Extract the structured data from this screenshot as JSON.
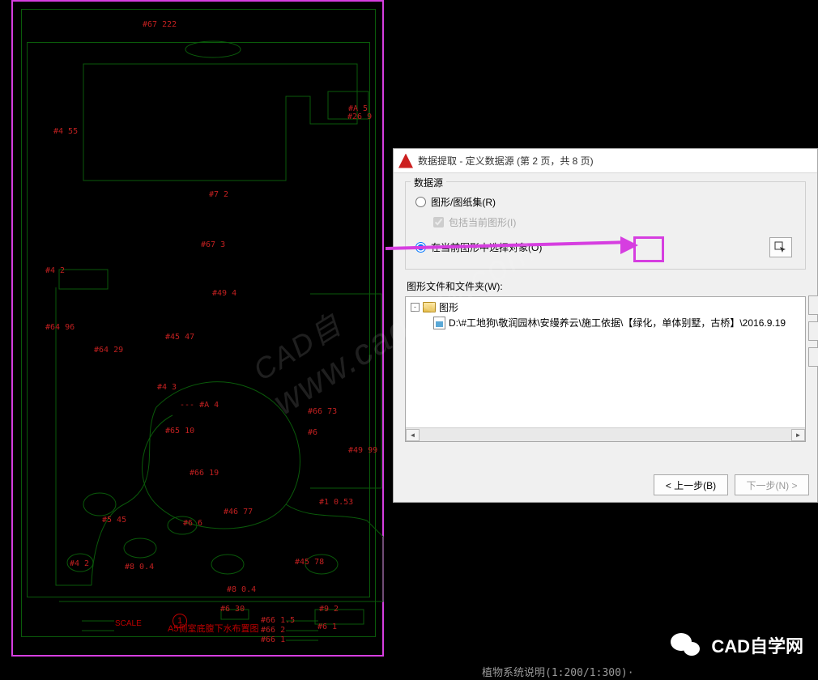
{
  "cad": {
    "labels": [
      {
        "t": "#67 222",
        "l": 150,
        "tp": 14
      },
      {
        "t": "#A 5",
        "l": 404,
        "tp": 118
      },
      {
        "t": "#4 55",
        "l": 40,
        "tp": 146
      },
      {
        "t": "#67 3",
        "l": 222,
        "tp": 286
      },
      {
        "t": "#45 47",
        "l": 178,
        "tp": 400
      },
      {
        "t": "#65 10",
        "l": 178,
        "tp": 516
      },
      {
        "t": "#66 19",
        "l": 208,
        "tp": 568
      },
      {
        "t": "#64 96",
        "l": 30,
        "tp": 388
      },
      {
        "t": "#64 29",
        "l": 90,
        "tp": 416
      },
      {
        "t": "#4 2",
        "l": 30,
        "tp": 318
      },
      {
        "t": "#49 4",
        "l": 236,
        "tp": 346
      },
      {
        "t": "#7 2",
        "l": 232,
        "tp": 224
      },
      {
        "t": "#4 3",
        "l": 168,
        "tp": 462
      },
      {
        "t": "--- #A 4",
        "l": 196,
        "tp": 484
      },
      {
        "t": "#46 77",
        "l": 250,
        "tp": 616
      },
      {
        "t": "#5 45",
        "l": 100,
        "tp": 626
      },
      {
        "t": "#6 6",
        "l": 200,
        "tp": 630
      },
      {
        "t": "#4 2",
        "l": 60,
        "tp": 680
      },
      {
        "t": "#8 0.4",
        "l": 128,
        "tp": 684
      },
      {
        "t": "#45 78",
        "l": 338,
        "tp": 678
      },
      {
        "t": "#6",
        "l": 354,
        "tp": 518
      },
      {
        "t": "#66 73",
        "l": 354,
        "tp": 492
      },
      {
        "t": "#1 0.53",
        "l": 368,
        "tp": 604
      },
      {
        "t": "#8 0.4",
        "l": 254,
        "tp": 712
      },
      {
        "t": "#6 30",
        "l": 246,
        "tp": 736
      },
      {
        "t": "#9 2",
        "l": 368,
        "tp": 736
      },
      {
        "t": "#6 1",
        "l": 366,
        "tp": 758
      },
      {
        "t": "#66 1.5",
        "l": 296,
        "tp": 750
      },
      {
        "t": "#66 2",
        "l": 296,
        "tp": 762
      },
      {
        "t": "#66 1",
        "l": 296,
        "tp": 774
      },
      {
        "t": "#49 99",
        "l": 404,
        "tp": 540
      },
      {
        "t": "#26 9",
        "l": 403,
        "tp": 128
      }
    ],
    "title": "A5侧室底腹下水布置图",
    "num": "1",
    "scale": "SCALE"
  },
  "ratio": "植物系统说明(1:200/1:300)·",
  "dialog": {
    "title": "数据提取 - 定义数据源 (第 2 页，共 8 页)",
    "group": "数据源",
    "radio1": "图形/图纸集(R)",
    "check1": "包括当前图形(I)",
    "radio2": "在当前图形中选择对象(O)",
    "files_label": "图形文件和文件夹(W):",
    "tree_root": "图形",
    "tree_child": "D:\\#工地狗\\敬润园林\\安缦养云\\施工依据\\【绿化，单体别墅，古桥】\\2016.9.19",
    "back": "< 上一步(B)",
    "next": "下一步(N) >"
  },
  "watermark_cn": "CAD自",
  "watermark_url": "www.cadzxw.com",
  "brand": "CAD自学网"
}
